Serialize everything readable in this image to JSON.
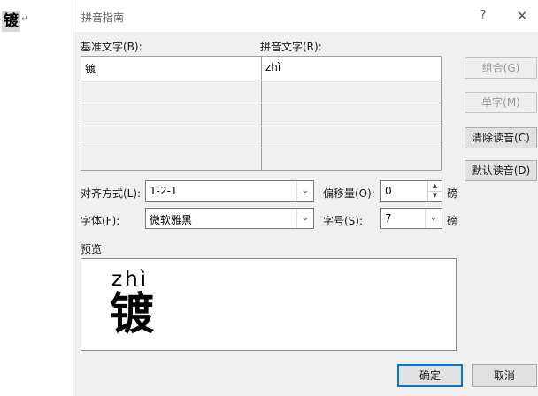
{
  "document": {
    "char": "镀",
    "mark": "↵"
  },
  "dialog": {
    "title": "拼音指南",
    "help": "?",
    "close": "✕",
    "base_label": "基准文字(B):",
    "ruby_label": "拼音文字(R):",
    "rows": [
      {
        "base": "镀",
        "ruby": "zhì"
      },
      {
        "base": "",
        "ruby": ""
      },
      {
        "base": "",
        "ruby": ""
      },
      {
        "base": "",
        "ruby": ""
      },
      {
        "base": "",
        "ruby": ""
      }
    ],
    "buttons": {
      "group": "组合(G)",
      "mono": "单字(M)",
      "clear": "清除读音(C)",
      "default": "默认读音(D)"
    },
    "alignment_label": "对齐方式(L):",
    "alignment_value": "1-2-1",
    "offset_label": "偏移量(O):",
    "offset_value": "0",
    "offset_unit": "磅",
    "font_label": "字体(F):",
    "font_value": "微软雅黑",
    "size_label": "字号(S):",
    "size_value": "7",
    "size_unit": "磅",
    "preview_label": "预览",
    "preview_pinyin": "zhì",
    "preview_char": "镀",
    "ok": "确定",
    "cancel": "取消"
  }
}
